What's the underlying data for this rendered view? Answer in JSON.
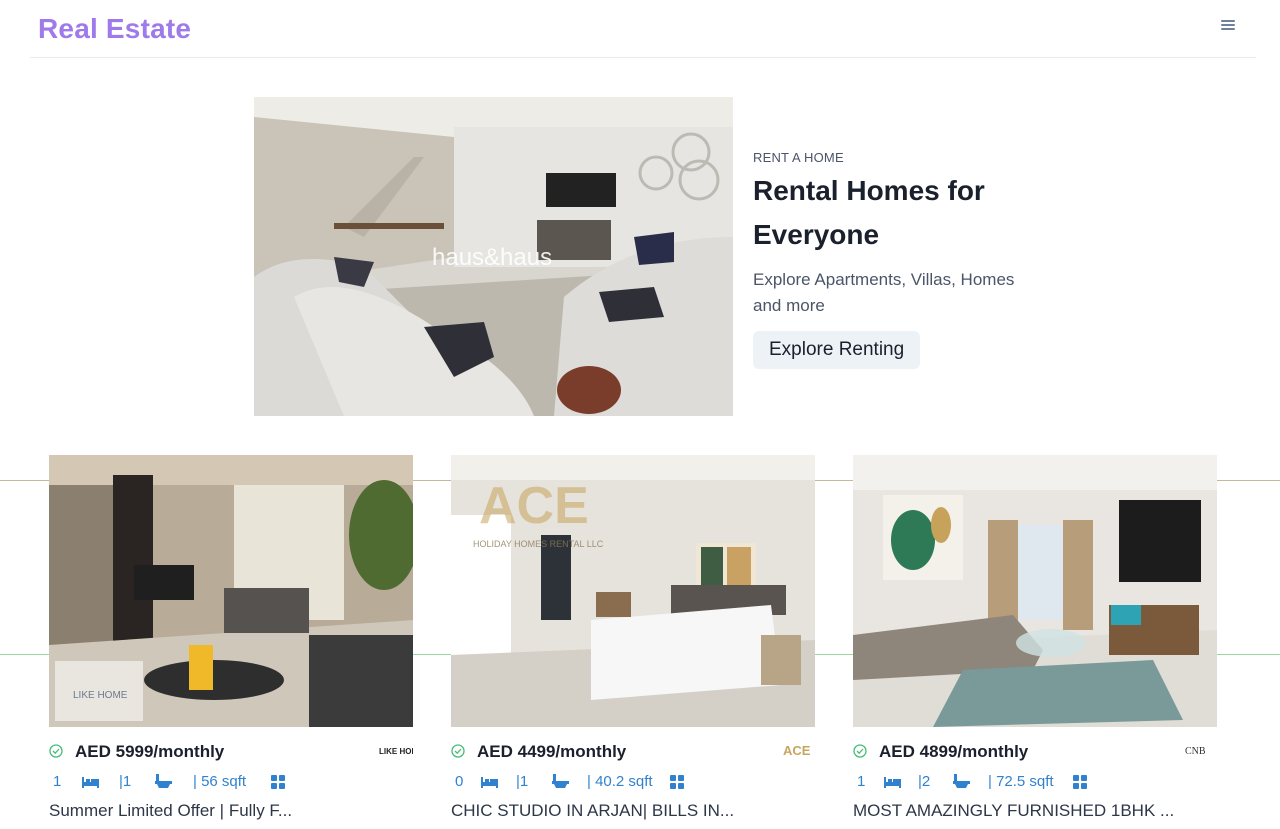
{
  "header": {
    "logo": "Real Estate",
    "menu_icon": "hamburger-menu-icon"
  },
  "hero": {
    "image_watermark": "haus&haus",
    "eyebrow": "RENT A HOME",
    "title": "Rental Homes for Everyone",
    "subtitle": "Explore Apartments, Villas, Homes and more",
    "cta_label": "Explore Renting"
  },
  "colors": {
    "brand": "#9f7aea",
    "accent": "#3182ce",
    "verified": "#48bb78",
    "button_bg": "#edf2f7"
  },
  "listings": [
    {
      "price": "AED 5999/monthly",
      "rooms": "1",
      "baths": "|1",
      "area": "| 56 sqft",
      "title": "Summer Limited Offer | Fully F...",
      "agency_logo_text": "LIKE HOME",
      "thumb_watermark": "LIKE HOME"
    },
    {
      "price": "AED 4499/monthly",
      "rooms": "0",
      "baths": "|1",
      "area": "| 40.2 sqft",
      "title": "CHIC STUDIO IN ARJAN| BILLS IN...",
      "agency_logo_text": "ACE",
      "thumb_watermark": "ACE",
      "thumb_watermark_sub": "HOLIDAY HOMES RENTAL LLC"
    },
    {
      "price": "AED 4899/monthly",
      "rooms": "1",
      "baths": "|2",
      "area": "| 72.5 sqft",
      "title": "MOST AMAZINGLY FURNISHED 1BHK ...",
      "agency_logo_text": "CNB"
    }
  ]
}
